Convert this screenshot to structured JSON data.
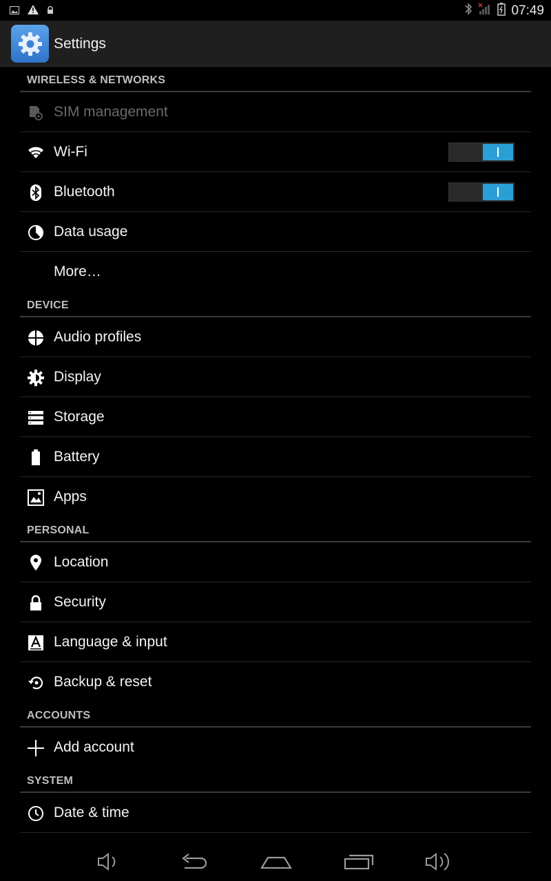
{
  "status_bar": {
    "time": "07:49"
  },
  "app_bar": {
    "title": "Settings"
  },
  "sections": [
    {
      "header": "WIRELESS & NETWORKS",
      "items": [
        {
          "label": "SIM management",
          "icon": "sim-icon",
          "disabled": true
        },
        {
          "label": "Wi-Fi",
          "icon": "wifi-icon",
          "toggle": true
        },
        {
          "label": "Bluetooth",
          "icon": "bluetooth-icon",
          "toggle": true
        },
        {
          "label": "Data usage",
          "icon": "data-usage-icon"
        },
        {
          "label": "More…",
          "icon": ""
        }
      ]
    },
    {
      "header": "DEVICE",
      "items": [
        {
          "label": "Audio profiles",
          "icon": "audio-profiles-icon"
        },
        {
          "label": "Display",
          "icon": "display-icon"
        },
        {
          "label": "Storage",
          "icon": "storage-icon"
        },
        {
          "label": "Battery",
          "icon": "battery-icon"
        },
        {
          "label": "Apps",
          "icon": "apps-icon"
        }
      ]
    },
    {
      "header": "PERSONAL",
      "items": [
        {
          "label": "Location",
          "icon": "location-icon"
        },
        {
          "label": "Security",
          "icon": "lock-icon"
        },
        {
          "label": "Language & input",
          "icon": "language-icon"
        },
        {
          "label": "Backup & reset",
          "icon": "backup-icon"
        }
      ]
    },
    {
      "header": "ACCOUNTS",
      "items": [
        {
          "label": "Add account",
          "icon": "plus-icon"
        }
      ]
    },
    {
      "header": "SYSTEM",
      "items": [
        {
          "label": "Date & time",
          "icon": "clock-icon"
        }
      ]
    }
  ],
  "colors": {
    "accent": "#2a9fd6",
    "background": "#000000",
    "header_text": "#bfbfbf"
  }
}
